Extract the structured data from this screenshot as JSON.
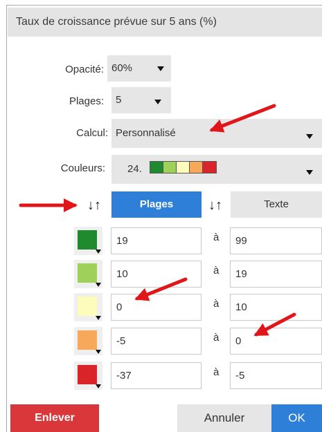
{
  "dialog": {
    "title": "Taux de croissance prévue sur 5 ans (%)"
  },
  "settings": {
    "opacity_label": "Opacité:",
    "opacity_value": "60%",
    "ranges_label": "Plages:",
    "ranges_value": "5",
    "calc_label": "Calcul:",
    "calc_value": "Personnalisé",
    "colors_label": "Couleurs:",
    "colors_value": "24.",
    "palette": [
      "#1f8a2e",
      "#9ed05a",
      "#fdfcbc",
      "#f7a85a",
      "#d9252a"
    ]
  },
  "tabs": {
    "ranges": "Plages",
    "text": "Texte"
  },
  "rows": [
    {
      "color": "#1f8a2e",
      "from": "19",
      "sep": "à",
      "to": "99"
    },
    {
      "color": "#9ed05a",
      "from": "10",
      "sep": "à",
      "to": "19"
    },
    {
      "color": "#fdfcbc",
      "from": "0",
      "sep": "à",
      "to": "10"
    },
    {
      "color": "#f7a85a",
      "from": "-5",
      "sep": "à",
      "to": "0"
    },
    {
      "color": "#d9252a",
      "from": "-37",
      "sep": "à",
      "to": "-5"
    }
  ],
  "footer": {
    "remove": "Enlever",
    "cancel": "Annuler",
    "ok": "OK"
  },
  "annotation": {
    "arrow_color": "#e0161a"
  }
}
